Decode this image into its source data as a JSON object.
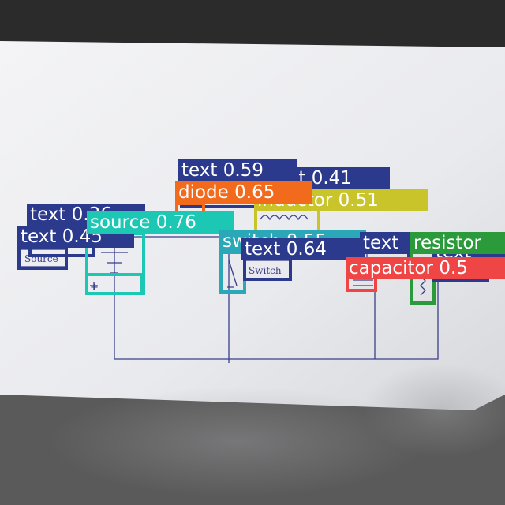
{
  "image": {
    "sketch_labels": {
      "source": "Source",
      "switch": "Switch",
      "polarity_plus": "+"
    }
  },
  "detections": [
    {
      "id": "text_059",
      "label": "text 0.59",
      "color": "#2b3a8c"
    },
    {
      "id": "text_041",
      "label": "text 0.41",
      "color": "#2b3a8c"
    },
    {
      "id": "diode_065",
      "label": "diode 0.65",
      "color": "#f26b1d"
    },
    {
      "id": "inductor_051",
      "label": "inductor 0.51",
      "color": "#c8c42a"
    },
    {
      "id": "text_036",
      "label": "text 0.36",
      "color": "#2b3a8c"
    },
    {
      "id": "source_076",
      "label": "source 0.76",
      "color": "#1cc8b4"
    },
    {
      "id": "text_045",
      "label": "text 0.45",
      "color": "#2b3a8c"
    },
    {
      "id": "switch_055",
      "label": "switch 0.55",
      "color": "#2aa8b8"
    },
    {
      "id": "text_064",
      "label": "text 0.64",
      "color": "#2b3a8c"
    },
    {
      "id": "text_mid",
      "label": "text",
      "color": "#2b3a8c"
    },
    {
      "id": "resistor",
      "label": "resistor",
      "color": "#2a9a3a"
    },
    {
      "id": "capacitor",
      "label": "capacitor 0.5",
      "color": "#f04545"
    },
    {
      "id": "text_right",
      "label": "text",
      "color": "#2b3a8c"
    }
  ]
}
